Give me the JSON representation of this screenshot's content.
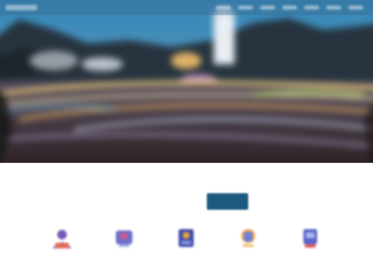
{
  "hero": {
    "scene": "night-city-long-exposure"
  },
  "top_nav": {
    "items": [
      "",
      "",
      "",
      "",
      "",
      "",
      ""
    ]
  },
  "section": {
    "title_red": "",
    "title_dark": ""
  },
  "tabs": [
    {
      "label": "",
      "active": false
    },
    {
      "label": "",
      "active": true
    },
    {
      "label": "",
      "active": false
    },
    {
      "label": "",
      "active": false
    }
  ],
  "services": [
    {
      "icon": "service-1-icon",
      "label": ""
    },
    {
      "icon": "service-2-icon",
      "label": ""
    },
    {
      "icon": "service-3-icon",
      "label": ""
    },
    {
      "icon": "service-4-icon",
      "label": ""
    },
    {
      "icon": "service-5-icon",
      "label": ""
    }
  ],
  "colors": {
    "accent_red": "#cc2f2f",
    "active_tab": "#1e5a7f",
    "title_dark": "#3a4458"
  }
}
